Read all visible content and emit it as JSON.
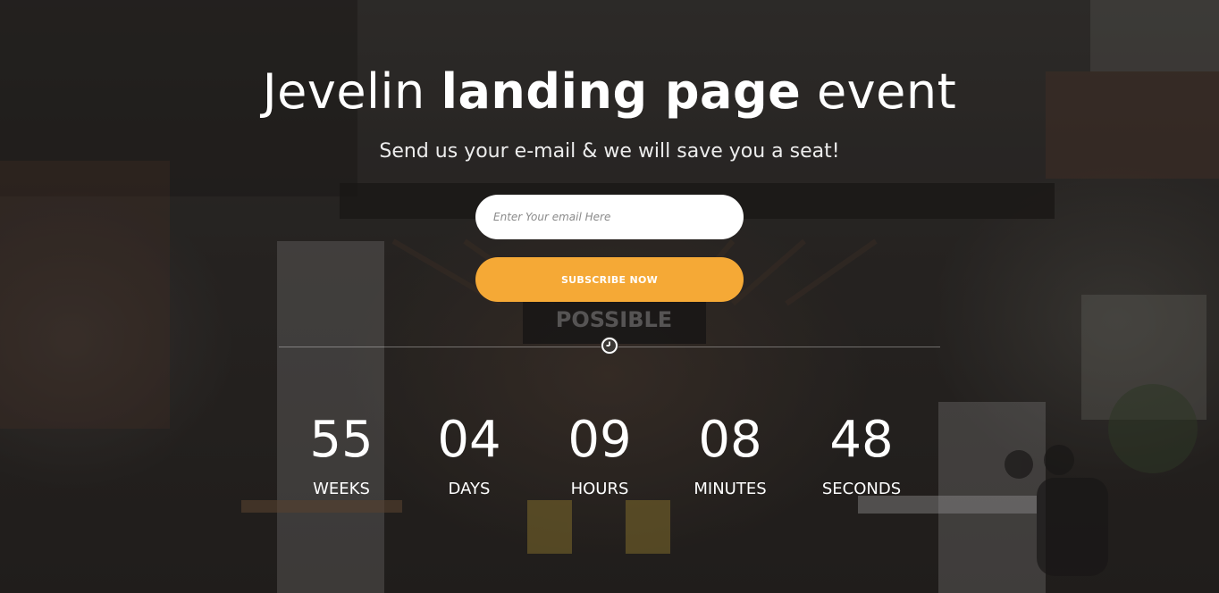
{
  "hero": {
    "title_part1": "Jevelin",
    "title_bold": "landing page",
    "title_part2": "event",
    "subtitle": "Send us your e-mail & we will save you a seat!"
  },
  "signup": {
    "email_placeholder": "Enter Your email Here",
    "email_value": "",
    "subscribe_label": "SUBSCRIBE NOW"
  },
  "background": {
    "sign_text": "POSSIBLE"
  },
  "countdown": {
    "icon": "clock-icon",
    "units": [
      {
        "value": "55",
        "label": "WEEKS"
      },
      {
        "value": "04",
        "label": "DAYS"
      },
      {
        "value": "09",
        "label": "HOURS"
      },
      {
        "value": "08",
        "label": "MINUTES"
      },
      {
        "value": "48",
        "label": "SECONDS"
      }
    ]
  },
  "colors": {
    "accent": "#f5a936",
    "text": "#ffffff",
    "input_bg": "#ffffff"
  }
}
